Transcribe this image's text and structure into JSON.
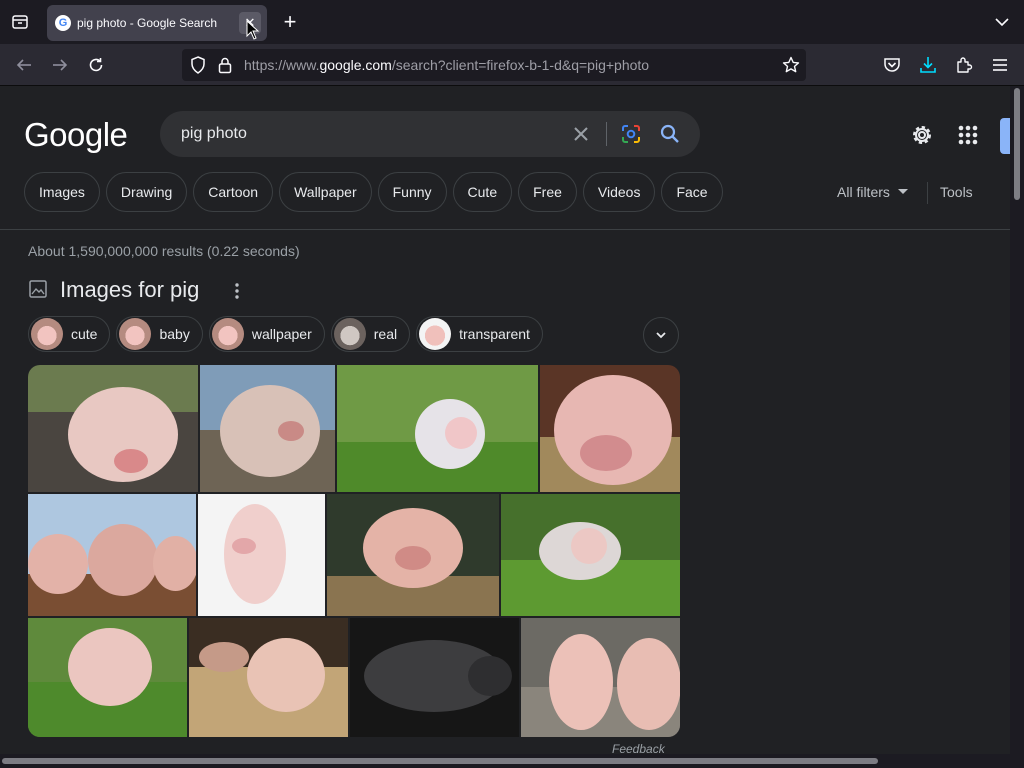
{
  "browser": {
    "tab": {
      "title": "pig photo - Google Search",
      "favicon": "google-g-icon"
    },
    "url": {
      "prefix": "https://www.",
      "domain": "google.com",
      "path": "/search?client=firefox-b-1-d&q=pig+photo"
    }
  },
  "google": {
    "logo": "Google",
    "query": "pig photo",
    "chips": [
      "Images",
      "Drawing",
      "Cartoon",
      "Wallpaper",
      "Funny",
      "Cute",
      "Free",
      "Videos",
      "Face"
    ],
    "all_filters": "All filters",
    "tools": "Tools",
    "stats": "About 1,590,000,000 results (0.22 seconds)",
    "images_header": "Images for pig",
    "suggestions": [
      "cute",
      "baby",
      "wallpaper",
      "real",
      "transparent"
    ],
    "feedback": "Feedback"
  },
  "colors": {
    "accent": "#8ab4f8",
    "page_bg": "#202124",
    "chrome_bg": "#1c1b22",
    "toolbar_bg": "#2b2a33",
    "download_icon": "#00ddff"
  }
}
